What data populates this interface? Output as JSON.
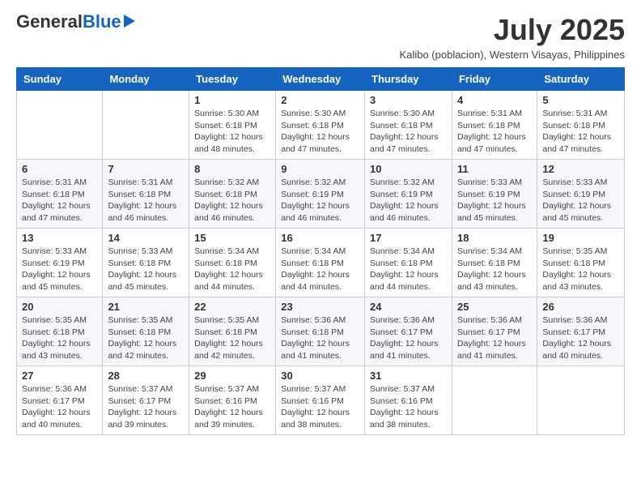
{
  "logo": {
    "general": "General",
    "blue": "Blue"
  },
  "title": "July 2025",
  "subtitle": "Kalibo (poblacion), Western Visayas, Philippines",
  "headers": [
    "Sunday",
    "Monday",
    "Tuesday",
    "Wednesday",
    "Thursday",
    "Friday",
    "Saturday"
  ],
  "weeks": [
    [
      {
        "day": "",
        "info": ""
      },
      {
        "day": "",
        "info": ""
      },
      {
        "day": "1",
        "info": "Sunrise: 5:30 AM\nSunset: 6:18 PM\nDaylight: 12 hours and 48 minutes."
      },
      {
        "day": "2",
        "info": "Sunrise: 5:30 AM\nSunset: 6:18 PM\nDaylight: 12 hours and 47 minutes."
      },
      {
        "day": "3",
        "info": "Sunrise: 5:30 AM\nSunset: 6:18 PM\nDaylight: 12 hours and 47 minutes."
      },
      {
        "day": "4",
        "info": "Sunrise: 5:31 AM\nSunset: 6:18 PM\nDaylight: 12 hours and 47 minutes."
      },
      {
        "day": "5",
        "info": "Sunrise: 5:31 AM\nSunset: 6:18 PM\nDaylight: 12 hours and 47 minutes."
      }
    ],
    [
      {
        "day": "6",
        "info": "Sunrise: 5:31 AM\nSunset: 6:18 PM\nDaylight: 12 hours and 47 minutes."
      },
      {
        "day": "7",
        "info": "Sunrise: 5:31 AM\nSunset: 6:18 PM\nDaylight: 12 hours and 46 minutes."
      },
      {
        "day": "8",
        "info": "Sunrise: 5:32 AM\nSunset: 6:18 PM\nDaylight: 12 hours and 46 minutes."
      },
      {
        "day": "9",
        "info": "Sunrise: 5:32 AM\nSunset: 6:19 PM\nDaylight: 12 hours and 46 minutes."
      },
      {
        "day": "10",
        "info": "Sunrise: 5:32 AM\nSunset: 6:19 PM\nDaylight: 12 hours and 46 minutes."
      },
      {
        "day": "11",
        "info": "Sunrise: 5:33 AM\nSunset: 6:19 PM\nDaylight: 12 hours and 45 minutes."
      },
      {
        "day": "12",
        "info": "Sunrise: 5:33 AM\nSunset: 6:19 PM\nDaylight: 12 hours and 45 minutes."
      }
    ],
    [
      {
        "day": "13",
        "info": "Sunrise: 5:33 AM\nSunset: 6:19 PM\nDaylight: 12 hours and 45 minutes."
      },
      {
        "day": "14",
        "info": "Sunrise: 5:33 AM\nSunset: 6:18 PM\nDaylight: 12 hours and 45 minutes."
      },
      {
        "day": "15",
        "info": "Sunrise: 5:34 AM\nSunset: 6:18 PM\nDaylight: 12 hours and 44 minutes."
      },
      {
        "day": "16",
        "info": "Sunrise: 5:34 AM\nSunset: 6:18 PM\nDaylight: 12 hours and 44 minutes."
      },
      {
        "day": "17",
        "info": "Sunrise: 5:34 AM\nSunset: 6:18 PM\nDaylight: 12 hours and 44 minutes."
      },
      {
        "day": "18",
        "info": "Sunrise: 5:34 AM\nSunset: 6:18 PM\nDaylight: 12 hours and 43 minutes."
      },
      {
        "day": "19",
        "info": "Sunrise: 5:35 AM\nSunset: 6:18 PM\nDaylight: 12 hours and 43 minutes."
      }
    ],
    [
      {
        "day": "20",
        "info": "Sunrise: 5:35 AM\nSunset: 6:18 PM\nDaylight: 12 hours and 43 minutes."
      },
      {
        "day": "21",
        "info": "Sunrise: 5:35 AM\nSunset: 6:18 PM\nDaylight: 12 hours and 42 minutes."
      },
      {
        "day": "22",
        "info": "Sunrise: 5:35 AM\nSunset: 6:18 PM\nDaylight: 12 hours and 42 minutes."
      },
      {
        "day": "23",
        "info": "Sunrise: 5:36 AM\nSunset: 6:18 PM\nDaylight: 12 hours and 41 minutes."
      },
      {
        "day": "24",
        "info": "Sunrise: 5:36 AM\nSunset: 6:17 PM\nDaylight: 12 hours and 41 minutes."
      },
      {
        "day": "25",
        "info": "Sunrise: 5:36 AM\nSunset: 6:17 PM\nDaylight: 12 hours and 41 minutes."
      },
      {
        "day": "26",
        "info": "Sunrise: 5:36 AM\nSunset: 6:17 PM\nDaylight: 12 hours and 40 minutes."
      }
    ],
    [
      {
        "day": "27",
        "info": "Sunrise: 5:36 AM\nSunset: 6:17 PM\nDaylight: 12 hours and 40 minutes."
      },
      {
        "day": "28",
        "info": "Sunrise: 5:37 AM\nSunset: 6:17 PM\nDaylight: 12 hours and 39 minutes."
      },
      {
        "day": "29",
        "info": "Sunrise: 5:37 AM\nSunset: 6:16 PM\nDaylight: 12 hours and 39 minutes."
      },
      {
        "day": "30",
        "info": "Sunrise: 5:37 AM\nSunset: 6:16 PM\nDaylight: 12 hours and 38 minutes."
      },
      {
        "day": "31",
        "info": "Sunrise: 5:37 AM\nSunset: 6:16 PM\nDaylight: 12 hours and 38 minutes."
      },
      {
        "day": "",
        "info": ""
      },
      {
        "day": "",
        "info": ""
      }
    ]
  ]
}
